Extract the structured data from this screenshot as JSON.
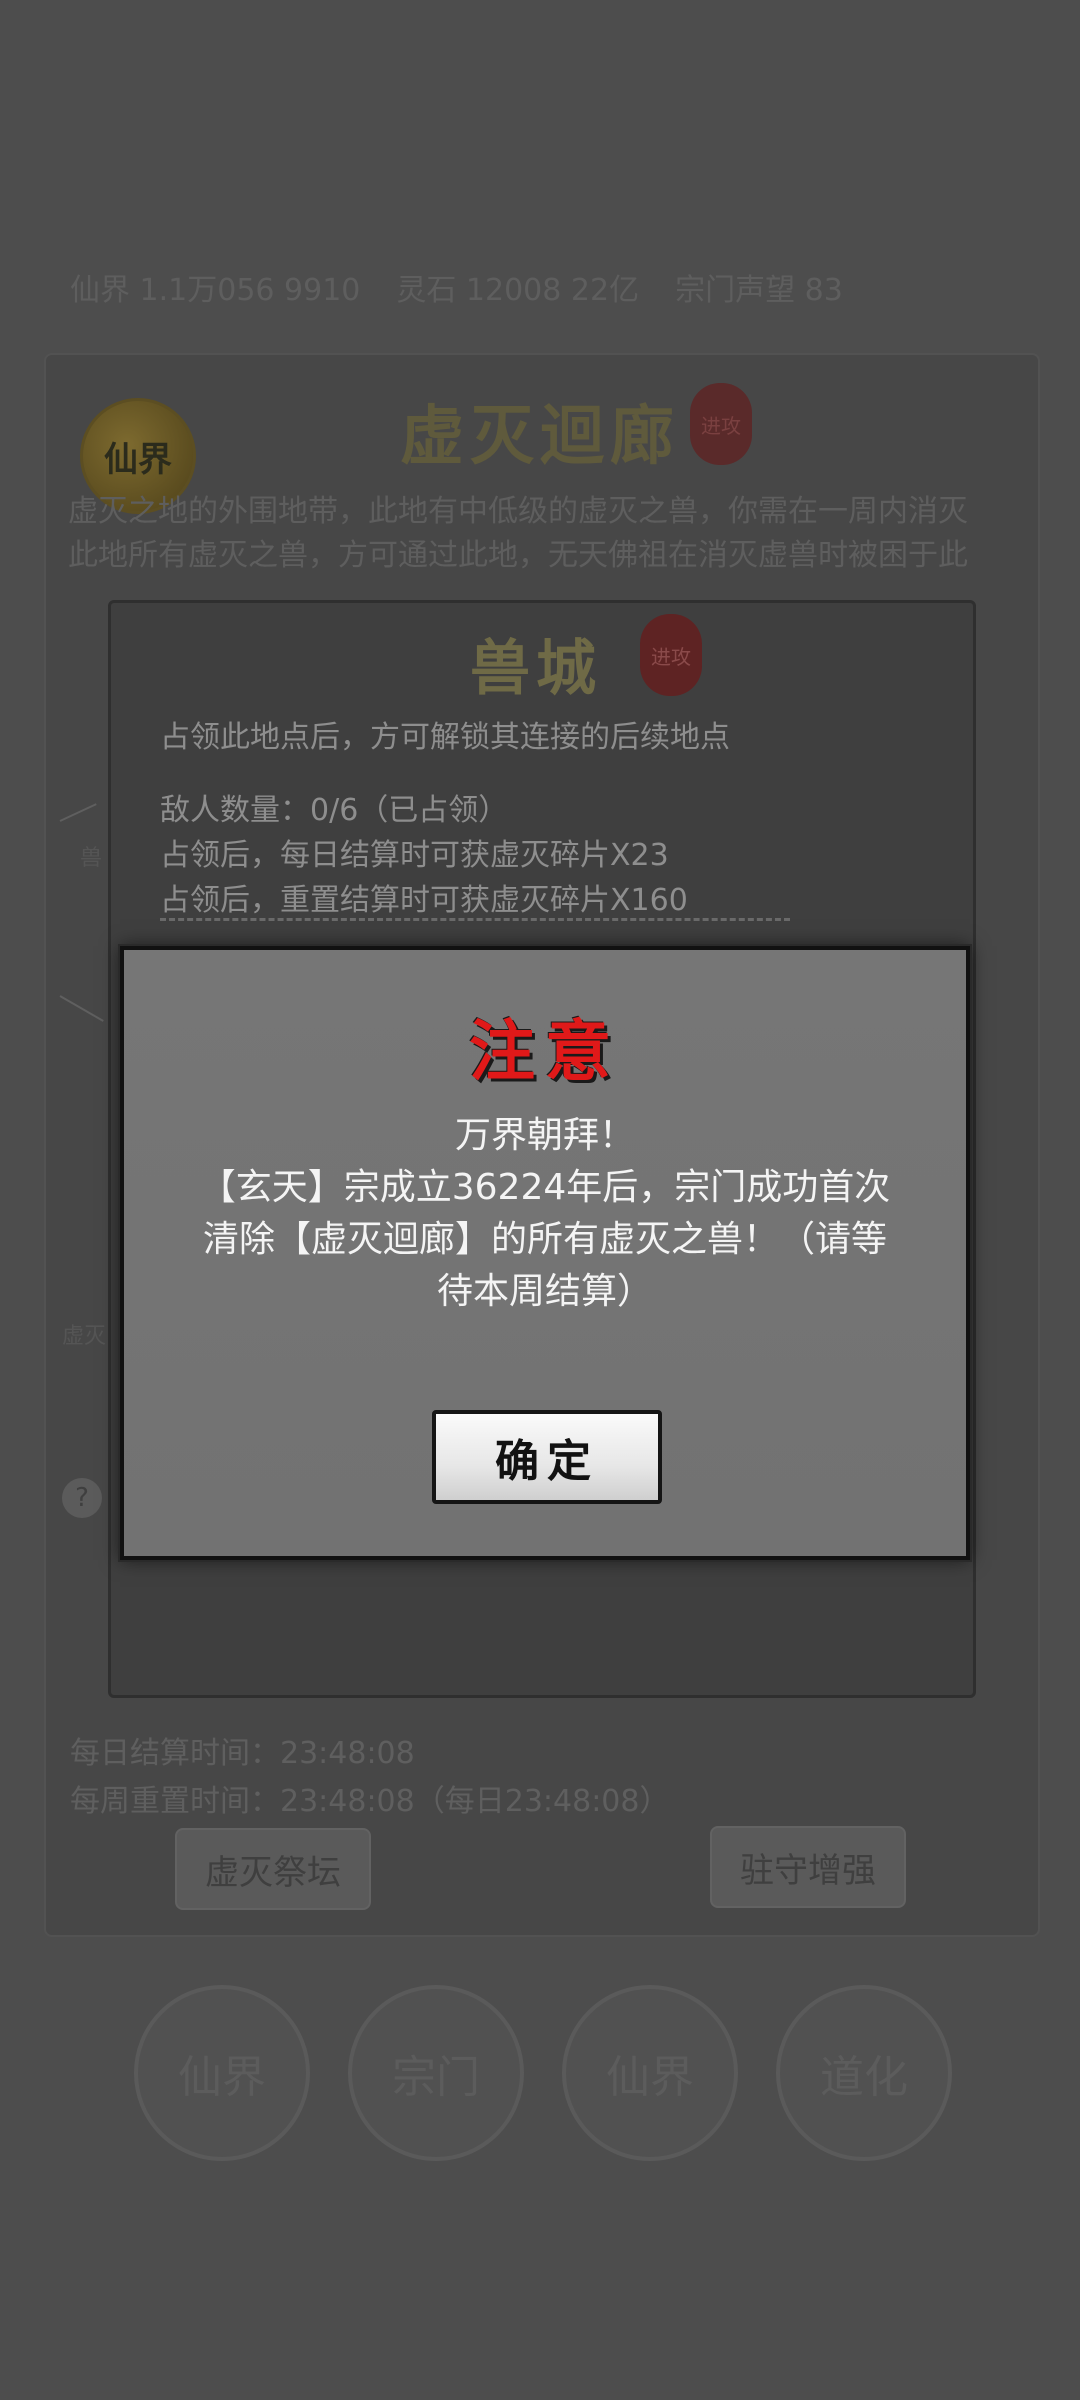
{
  "background": {
    "stats": [
      "仙界 1.1万056 9910",
      "灵石 12008 22亿",
      "宗门声望 83"
    ],
    "region": {
      "emblem_text": "仙界",
      "title": "虚灭迴廊",
      "seal_text": "进攻",
      "description": "虚灭之地的外围地带，此地有中低级的虚灭之兽，你需在一周内消灭此地所有虚灭之兽，方可通过此地，无天佛祖在消灭虚兽时被困于此"
    },
    "map_labels": [
      "兽",
      "虚灭"
    ],
    "help_icon_text": "?",
    "info": {
      "hidden1": "已占领",
      "hidden2": "每日",
      "hidden3": "每周",
      "daily_settlement": "每日结算时间：23:48:08",
      "weekly_reset": "每周重置时间：23:48:08（每日23:48:08）"
    },
    "buttons": {
      "altar": "虚灭祭坛",
      "garrison": "驻守增强"
    },
    "bottom_nav": [
      "仙界",
      "宗门",
      "仙界",
      "道化"
    ]
  },
  "beast_panel": {
    "title": "兽城",
    "seal_text": "进攻",
    "unlock_hint": "占领此地点后，方可解锁其连接的后续地点",
    "enemy_count": "敌人数量：0/6（已占领）",
    "daily_reward": "占领后，每日结算时可获虚灭碎片X23",
    "reset_reward": "占领后，重置结算时可获虚灭碎片X160"
  },
  "dialog": {
    "title": "注意",
    "line1": "万界朝拜！",
    "line2": "【玄天】宗成立36224年后，宗门成功首次",
    "line3": "清除【虚灭迴廊】的所有虚灭之兽！（请等",
    "line4": "待本周结算）",
    "confirm_label": "确定"
  }
}
